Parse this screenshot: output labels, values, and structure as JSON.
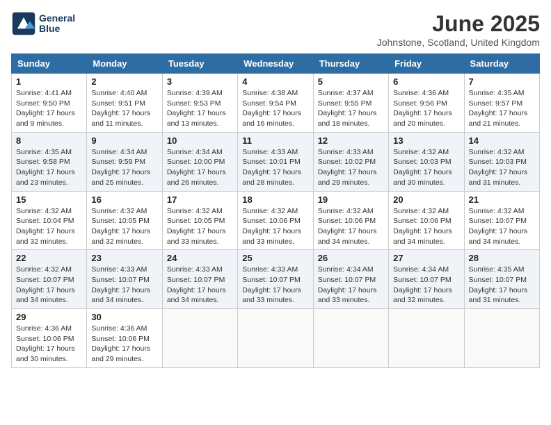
{
  "header": {
    "logo_line1": "General",
    "logo_line2": "Blue",
    "month_title": "June 2025",
    "location": "Johnstone, Scotland, United Kingdom"
  },
  "weekdays": [
    "Sunday",
    "Monday",
    "Tuesday",
    "Wednesday",
    "Thursday",
    "Friday",
    "Saturday"
  ],
  "weeks": [
    [
      {
        "day": "1",
        "info": "Sunrise: 4:41 AM\nSunset: 9:50 PM\nDaylight: 17 hours and 9 minutes."
      },
      {
        "day": "2",
        "info": "Sunrise: 4:40 AM\nSunset: 9:51 PM\nDaylight: 17 hours and 11 minutes."
      },
      {
        "day": "3",
        "info": "Sunrise: 4:39 AM\nSunset: 9:53 PM\nDaylight: 17 hours and 13 minutes."
      },
      {
        "day": "4",
        "info": "Sunrise: 4:38 AM\nSunset: 9:54 PM\nDaylight: 17 hours and 16 minutes."
      },
      {
        "day": "5",
        "info": "Sunrise: 4:37 AM\nSunset: 9:55 PM\nDaylight: 17 hours and 18 minutes."
      },
      {
        "day": "6",
        "info": "Sunrise: 4:36 AM\nSunset: 9:56 PM\nDaylight: 17 hours and 20 minutes."
      },
      {
        "day": "7",
        "info": "Sunrise: 4:35 AM\nSunset: 9:57 PM\nDaylight: 17 hours and 21 minutes."
      }
    ],
    [
      {
        "day": "8",
        "info": "Sunrise: 4:35 AM\nSunset: 9:58 PM\nDaylight: 17 hours and 23 minutes."
      },
      {
        "day": "9",
        "info": "Sunrise: 4:34 AM\nSunset: 9:59 PM\nDaylight: 17 hours and 25 minutes."
      },
      {
        "day": "10",
        "info": "Sunrise: 4:34 AM\nSunset: 10:00 PM\nDaylight: 17 hours and 26 minutes."
      },
      {
        "day": "11",
        "info": "Sunrise: 4:33 AM\nSunset: 10:01 PM\nDaylight: 17 hours and 28 minutes."
      },
      {
        "day": "12",
        "info": "Sunrise: 4:33 AM\nSunset: 10:02 PM\nDaylight: 17 hours and 29 minutes."
      },
      {
        "day": "13",
        "info": "Sunrise: 4:32 AM\nSunset: 10:03 PM\nDaylight: 17 hours and 30 minutes."
      },
      {
        "day": "14",
        "info": "Sunrise: 4:32 AM\nSunset: 10:03 PM\nDaylight: 17 hours and 31 minutes."
      }
    ],
    [
      {
        "day": "15",
        "info": "Sunrise: 4:32 AM\nSunset: 10:04 PM\nDaylight: 17 hours and 32 minutes."
      },
      {
        "day": "16",
        "info": "Sunrise: 4:32 AM\nSunset: 10:05 PM\nDaylight: 17 hours and 32 minutes."
      },
      {
        "day": "17",
        "info": "Sunrise: 4:32 AM\nSunset: 10:05 PM\nDaylight: 17 hours and 33 minutes."
      },
      {
        "day": "18",
        "info": "Sunrise: 4:32 AM\nSunset: 10:06 PM\nDaylight: 17 hours and 33 minutes."
      },
      {
        "day": "19",
        "info": "Sunrise: 4:32 AM\nSunset: 10:06 PM\nDaylight: 17 hours and 34 minutes."
      },
      {
        "day": "20",
        "info": "Sunrise: 4:32 AM\nSunset: 10:06 PM\nDaylight: 17 hours and 34 minutes."
      },
      {
        "day": "21",
        "info": "Sunrise: 4:32 AM\nSunset: 10:07 PM\nDaylight: 17 hours and 34 minutes."
      }
    ],
    [
      {
        "day": "22",
        "info": "Sunrise: 4:32 AM\nSunset: 10:07 PM\nDaylight: 17 hours and 34 minutes."
      },
      {
        "day": "23",
        "info": "Sunrise: 4:33 AM\nSunset: 10:07 PM\nDaylight: 17 hours and 34 minutes."
      },
      {
        "day": "24",
        "info": "Sunrise: 4:33 AM\nSunset: 10:07 PM\nDaylight: 17 hours and 34 minutes."
      },
      {
        "day": "25",
        "info": "Sunrise: 4:33 AM\nSunset: 10:07 PM\nDaylight: 17 hours and 33 minutes."
      },
      {
        "day": "26",
        "info": "Sunrise: 4:34 AM\nSunset: 10:07 PM\nDaylight: 17 hours and 33 minutes."
      },
      {
        "day": "27",
        "info": "Sunrise: 4:34 AM\nSunset: 10:07 PM\nDaylight: 17 hours and 32 minutes."
      },
      {
        "day": "28",
        "info": "Sunrise: 4:35 AM\nSunset: 10:07 PM\nDaylight: 17 hours and 31 minutes."
      }
    ],
    [
      {
        "day": "29",
        "info": "Sunrise: 4:36 AM\nSunset: 10:06 PM\nDaylight: 17 hours and 30 minutes."
      },
      {
        "day": "30",
        "info": "Sunrise: 4:36 AM\nSunset: 10:06 PM\nDaylight: 17 hours and 29 minutes."
      },
      {
        "day": "",
        "info": ""
      },
      {
        "day": "",
        "info": ""
      },
      {
        "day": "",
        "info": ""
      },
      {
        "day": "",
        "info": ""
      },
      {
        "day": "",
        "info": ""
      }
    ]
  ]
}
